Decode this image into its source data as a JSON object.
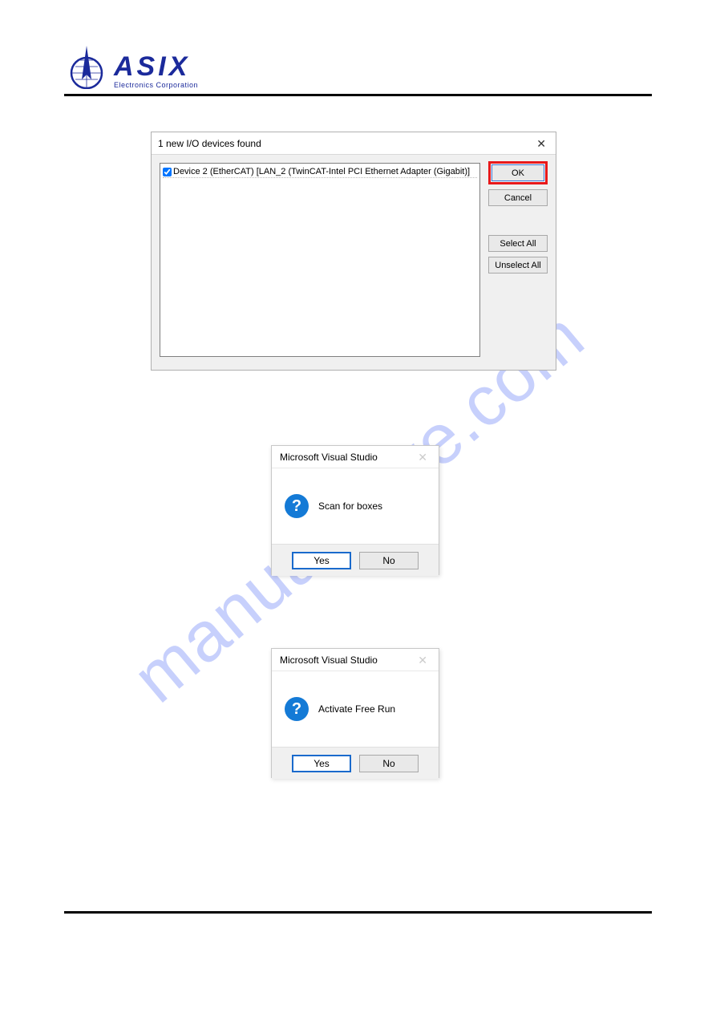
{
  "logo": {
    "brand": "ASIX",
    "tagline": "Electronics Corporation"
  },
  "watermark": "manualshive.com",
  "dialog1": {
    "title": "1 new I/O devices found",
    "device_label": "Device 2 (EtherCAT)     [LAN_2 (TwinCAT-Intel PCI Ethernet Adapter (Gigabit)]",
    "ok": "OK",
    "cancel": "Cancel",
    "select_all": "Select All",
    "unselect_all": "Unselect All"
  },
  "dialog2": {
    "title": "Microsoft Visual Studio",
    "message": "Scan for boxes",
    "yes": "Yes",
    "no": "No"
  },
  "dialog3": {
    "title": "Microsoft Visual Studio",
    "message": "Activate Free Run",
    "yes": "Yes",
    "no": "No"
  }
}
